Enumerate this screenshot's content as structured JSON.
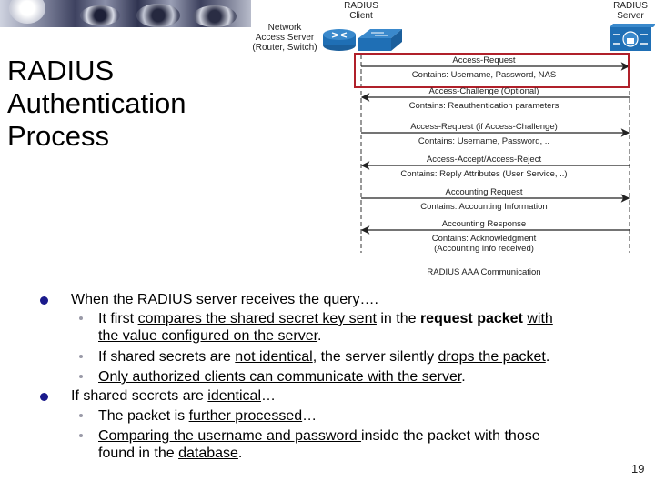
{
  "slide": {
    "title_lines": [
      "RADIUS",
      "Authentication",
      "Process"
    ],
    "page_number": "19"
  },
  "diagram": {
    "nas_label": [
      "Network",
      "Access Server",
      "(Router, Switch)"
    ],
    "client_label": [
      "RADIUS",
      "Client"
    ],
    "server_label": [
      "RADIUS",
      "Server"
    ],
    "highlight_color": "#b0202a",
    "device_color": "#1f6fb5",
    "caption": "RADIUS AAA Communication",
    "messages": [
      {
        "name": "Access-Request",
        "contains": "Contains: Username, Password, NAS",
        "direction": "to-server",
        "highlighted": true
      },
      {
        "name": "Access-Challenge (Optional)",
        "contains": "Contains: Reauthentication parameters",
        "direction": "to-client",
        "highlighted": false
      },
      {
        "name": "Access-Request (if Access-Challenge)",
        "contains": "Contains: Username, Password, ..",
        "direction": "to-server",
        "highlighted": false
      },
      {
        "name": "Access-Accept/Access-Reject",
        "contains": "Contains: Reply Attributes (User Service, ..)",
        "direction": "to-client",
        "highlighted": false
      },
      {
        "name": "Accounting Request",
        "contains": "Contains: Accounting Information",
        "direction": "to-server",
        "highlighted": false
      },
      {
        "name": "Accounting Response",
        "contains": "Contains: Acknowledgment",
        "contains2": "(Accounting info received)",
        "direction": "to-client",
        "highlighted": false
      }
    ]
  },
  "bullets": {
    "b1": "When the RADIUS server receives the query….",
    "b1_1": {
      "p1": "It first ",
      "u1": "compares the shared secret key sent",
      "p2": " in the ",
      "bold": "request packet",
      "p3": " ",
      "u2": "with",
      "u3": "the value configured on the server",
      "p4": "."
    },
    "b1_2": {
      "p1": "If shared secrets are ",
      "u1": "not identical",
      "p2": ", the server silently ",
      "u2": "drops the packet",
      "p3": "."
    },
    "b1_3": {
      "u1": "Only authorized clients can communicate with the server",
      "p1": "."
    },
    "b2": {
      "p1": "If shared secrets are ",
      "u1": "identical",
      "p2": "…"
    },
    "b2_1": {
      "p1": "The packet is ",
      "u1": "further processed",
      "p2": "…"
    },
    "b2_2": {
      "u1": "Comparing the username and password ",
      "p1": "inside the packet with those",
      "p2": "found in the ",
      "u2": "database",
      "p3": "."
    }
  }
}
